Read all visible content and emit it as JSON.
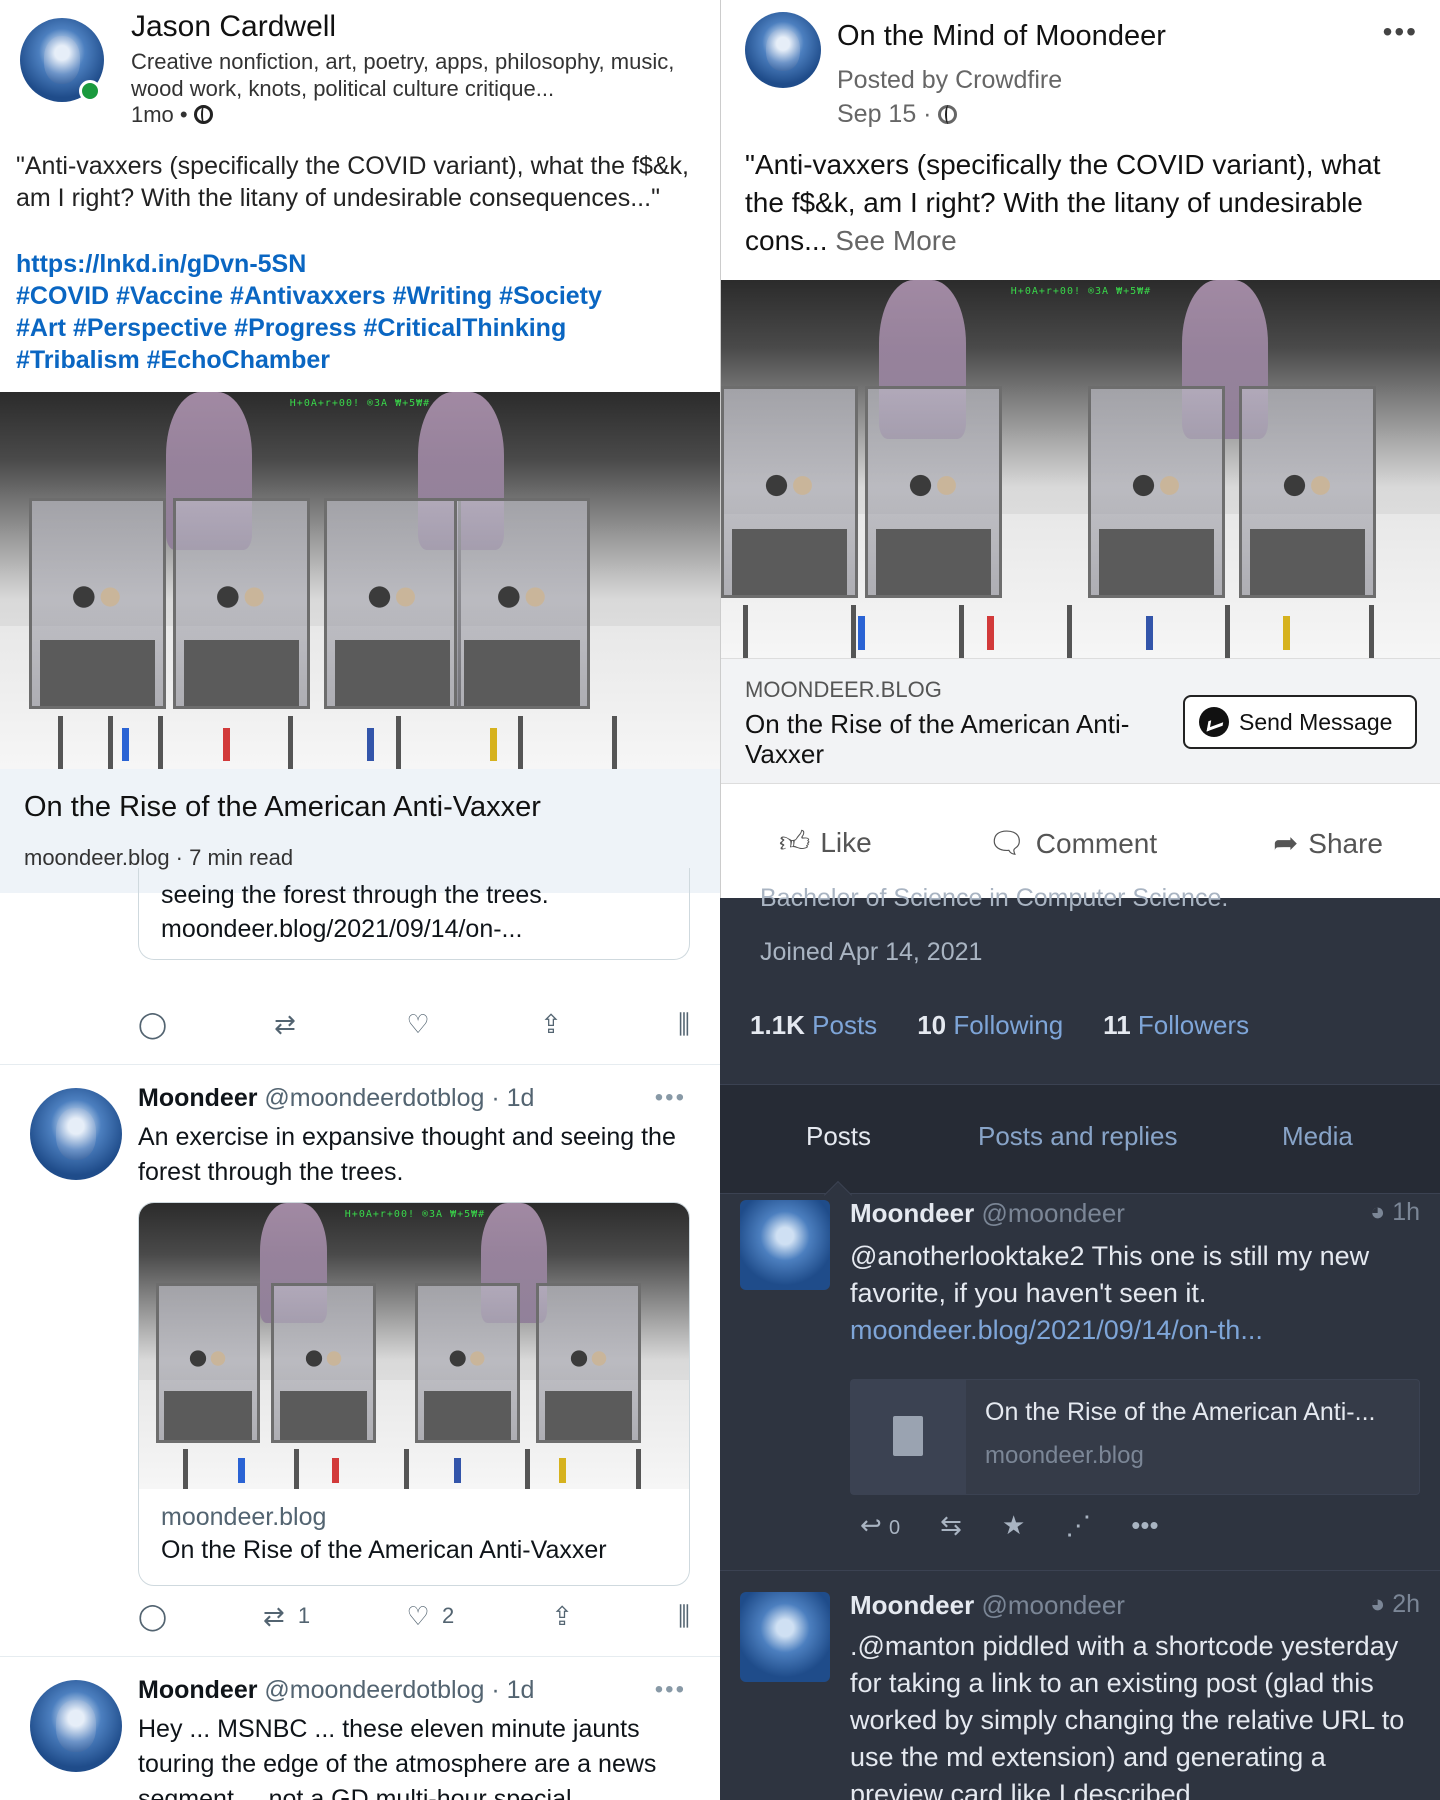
{
  "linkedin": {
    "author": "Jason Cardwell",
    "headline": "Creative nonfiction, art, poetry, apps, philosophy, music, wood work, knots, political culture critique...",
    "age": "1mo",
    "body": "\"Anti-vaxxers (specifically the COVID variant), what the f$&k, am I right? With the litany of undesirable consequences...\"",
    "link": "https://lnkd.in/gDvn-5SN",
    "hashtags_1": "#COVID #Vaccine #Antivaxxers #Writing #Society",
    "hashtags_2": "#Art #Perspective #Progress #CriticalThinking",
    "hashtags_3": "#Tribalism #EchoChamber",
    "card_title": "On the Rise of the American Anti-Vaxxer",
    "card_sub": "moondeer.blog · 7 min read"
  },
  "facebook": {
    "page": "On the Mind of Moondeer",
    "posted_by": "Posted by Crowdfire",
    "date": "Sep 15 ·",
    "body": "\"Anti-vaxxers (specifically the COVID variant), what the f$&k, am I right? With the litany of undesirable cons...",
    "see_more": "See More",
    "link_domain": "MOONDEER.BLOG",
    "link_title": "On the Rise of the American Anti-Vaxxer",
    "send_message": "Send Message",
    "like": "Like",
    "comment": "Comment",
    "share": "Share"
  },
  "twitter": {
    "quote_line1": "seeing the forest through the trees.",
    "quote_line2": "moondeer.blog/2021/09/14/on-...",
    "tweet1": {
      "name": "Moondeer",
      "handle": "@moondeerdotblog · 1d",
      "text": "An exercise in expansive thought and seeing the forest through the trees.",
      "card_domain": "moondeer.blog",
      "card_title": "On the Rise of the American Anti-Vaxxer",
      "retweets": "1",
      "likes": "2"
    },
    "tweet2": {
      "name": "Moondeer",
      "handle": "@moondeerdotblog · 1d",
      "text": "Hey ... MSNBC ... these eleven minute jaunts touring the edge of the atmosphere are a news segment ... not a GD multi-hour special"
    }
  },
  "microblog": {
    "bio_tail": "Bachelor of Science in Computer Science.",
    "joined": "Joined Apr 14, 2021",
    "posts_count": "1.1K",
    "posts_label": "Posts",
    "following_count": "10",
    "following_label": "Following",
    "followers_count": "11",
    "followers_label": "Followers",
    "tabs": [
      "Posts",
      "Posts and replies",
      "Media"
    ],
    "post1": {
      "name": "Moondeer",
      "handle": "@moondeer",
      "time": "1h",
      "text": "@anotherlooktake2 This one is still my new favorite, if you haven't seen it.",
      "link": "moondeer.blog/2021/09/14/on-th...",
      "card_title": "On the Rise of the American Anti-...",
      "card_domain": "moondeer.blog",
      "replies": "0"
    },
    "post2": {
      "name": "Moondeer",
      "handle": "@moondeer",
      "time": "2h",
      "text": ".@manton piddled with a shortcode yesterday for taking a link to an existing post (glad this worked by simply changing the relative URL to use the md extension) and generating a preview card like I described"
    }
  },
  "art_ticker": "H+0A+r+00! ®3A ₩+5₩#",
  "colors": {
    "linkedin_link": "#0a66c2",
    "dark_bg": "#2e3440",
    "dark_link": "#7ea5d8"
  }
}
